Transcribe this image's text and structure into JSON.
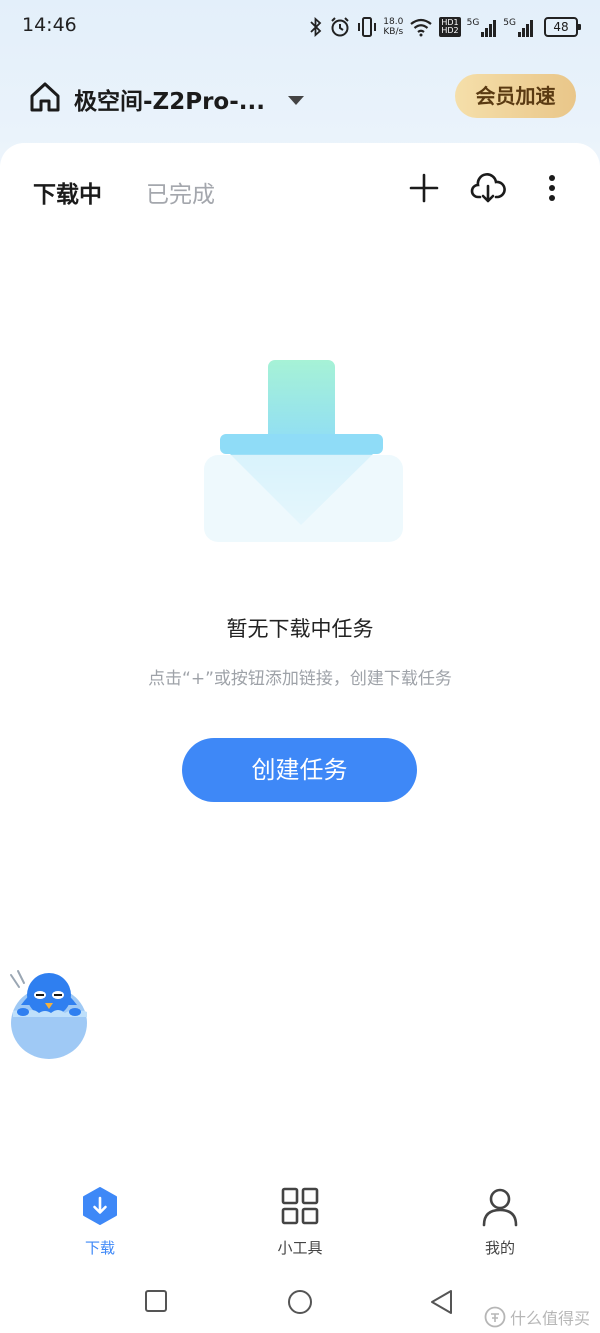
{
  "status_bar": {
    "time": "14:46",
    "speed_top": "18.0",
    "speed_unit": "KB/s",
    "hd1": "HD1",
    "hd2": "HD2",
    "net1": "5G",
    "net2": "5G",
    "battery": "48"
  },
  "header": {
    "device_name": "极空间-Z2Pro-...",
    "vip_label": "会员加速"
  },
  "tabs": {
    "downloading": "下载中",
    "completed": "已完成"
  },
  "empty_state": {
    "title": "暂无下载中任务",
    "hint": "点击“+”或按钮添加链接，创建下载任务",
    "button": "创建任务"
  },
  "bottom_nav": {
    "items": [
      {
        "label": "下载",
        "icon": "download-hexagon-icon",
        "active": true
      },
      {
        "label": "小工具",
        "icon": "grid-icon",
        "active": false
      },
      {
        "label": "我的",
        "icon": "person-icon",
        "active": false
      }
    ]
  },
  "watermark": "什么值得买",
  "colors": {
    "accent": "#3e88f7",
    "vip_gold": "#e9c689",
    "inactive_text": "#a4a7ad"
  }
}
